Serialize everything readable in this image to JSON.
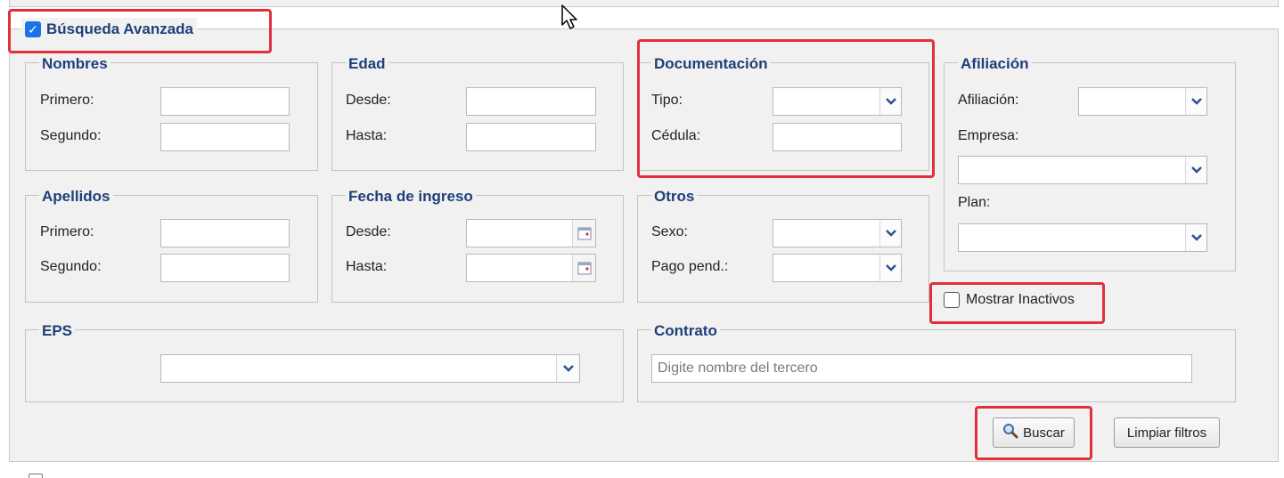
{
  "advanced_search": {
    "label": "Búsqueda Avanzada",
    "checked": true
  },
  "nombres": {
    "title": "Nombres",
    "first_label": "Primero:",
    "second_label": "Segundo:",
    "first_value": "",
    "second_value": ""
  },
  "edad": {
    "title": "Edad",
    "from_label": "Desde:",
    "to_label": "Hasta:",
    "from_value": "",
    "to_value": ""
  },
  "documentacion": {
    "title": "Documentación",
    "type_label": "Tipo:",
    "id_label": "Cédula:",
    "type_value": "",
    "id_value": ""
  },
  "afiliacion": {
    "title": "Afiliación",
    "affiliation_label": "Afiliación:",
    "company_label": "Empresa:",
    "plan_label": "Plan:",
    "affiliation_value": "",
    "company_value": "",
    "plan_value": ""
  },
  "apellidos": {
    "title": "Apellidos",
    "first_label": "Primero:",
    "second_label": "Segundo:",
    "first_value": "",
    "second_value": ""
  },
  "fecha_ingreso": {
    "title": "Fecha de ingreso",
    "from_label": "Desde:",
    "to_label": "Hasta:",
    "from_value": "",
    "to_value": ""
  },
  "otros": {
    "title": "Otros",
    "sex_label": "Sexo:",
    "pending_label": "Pago pend.:",
    "sex_value": "",
    "pending_value": ""
  },
  "mostrar_inactivos": {
    "label": "Mostrar Inactivos",
    "checked": false
  },
  "eps": {
    "title": "EPS",
    "value": ""
  },
  "contrato": {
    "title": "Contrato",
    "placeholder": "Digite nombre del tercero"
  },
  "buttons": {
    "search_label": "Buscar",
    "clear_label": "Limpiar filtros"
  },
  "icons": {
    "checkbox_checked": "check-icon",
    "dropdown": "chevron-down-icon",
    "calendar": "calendar-icon",
    "search": "magnifier-icon",
    "cursor": "mouse-pointer-icon"
  },
  "colors": {
    "title_blue": "#1f3f7a",
    "highlight_red": "#e0313a",
    "checkbox_blue": "#1a73e8",
    "panel_bg": "#f1f1f1"
  }
}
